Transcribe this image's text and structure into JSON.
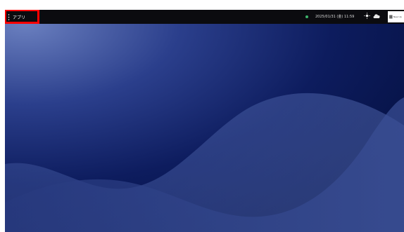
{
  "taskbar": {
    "apps_label": "アプリ",
    "datetime": "2025/01/31 (金) 11:59",
    "new_tile_label": "New Up"
  },
  "colors": {
    "taskbar_bg": "#0b0b0f",
    "highlight": "#ff0000",
    "status_dot": "#3db36b",
    "wallpaper_deep": "#061245",
    "wallpaper_mid": "#1a2d7a",
    "wallpaper_light": "#5c73b8"
  },
  "icons": {
    "apps": "grid-dots-icon",
    "status": "online-dot-icon",
    "weather_sun": "sun-icon",
    "weather_cloud": "cloud-icon",
    "new_tile": "pin-icon"
  }
}
